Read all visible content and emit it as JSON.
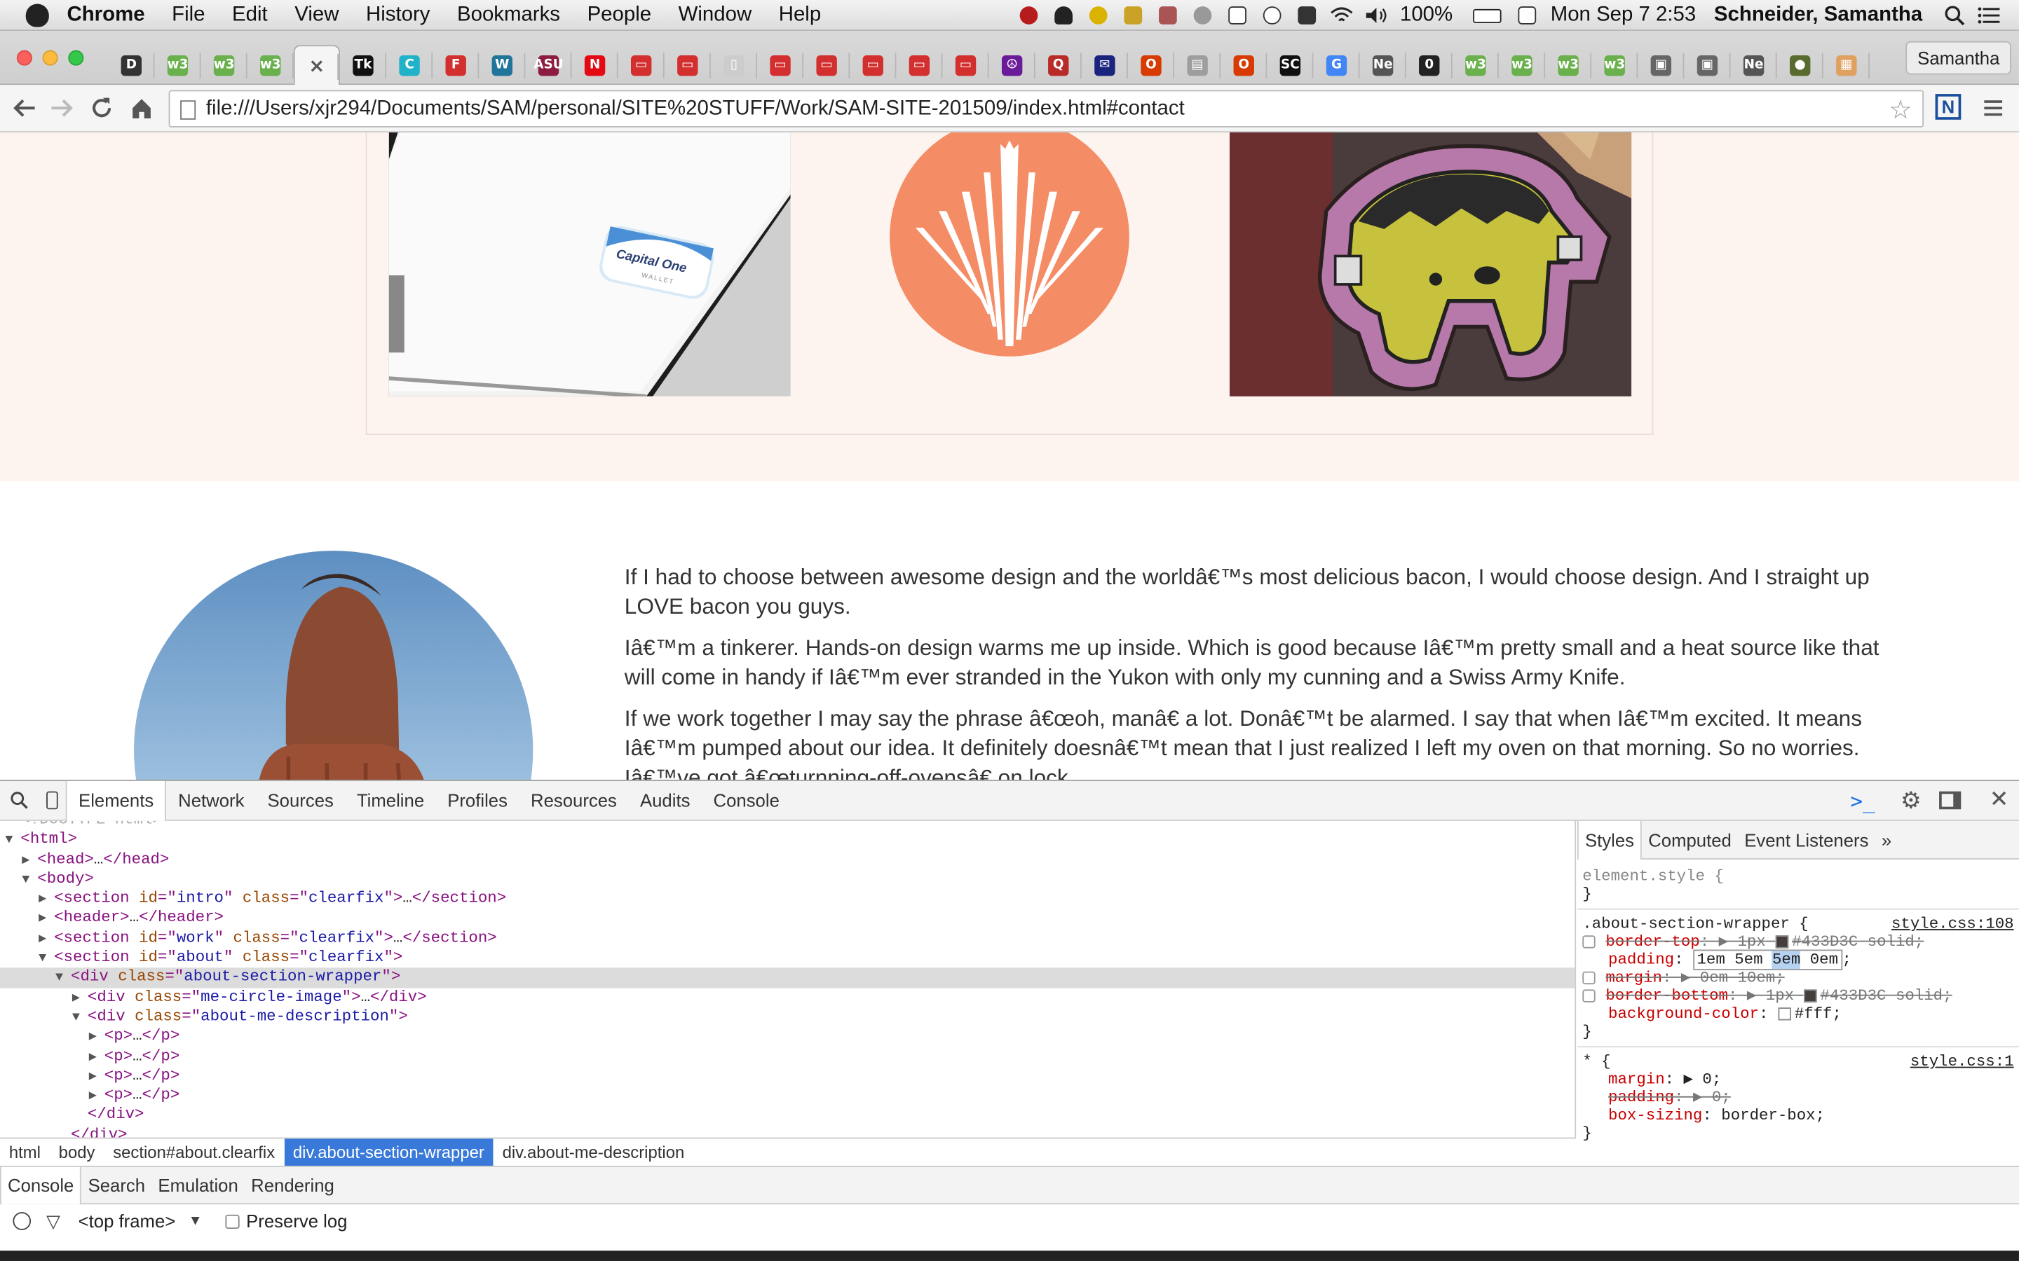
{
  "menubar": {
    "app": "Chrome",
    "items": [
      "File",
      "Edit",
      "View",
      "History",
      "Bookmarks",
      "People",
      "Window",
      "Help"
    ],
    "battery": "100%",
    "datetime": "Mon Sep 7  2:53",
    "user": "Schneider, Samantha"
  },
  "tabstrip": {
    "tabs": [
      {
        "fav": "D",
        "color": "#333333"
      },
      {
        "fav": "w3",
        "color": "#6ab04c"
      },
      {
        "fav": "w3",
        "color": "#6ab04c"
      },
      {
        "fav": "w3",
        "color": "#6ab04c"
      },
      {
        "fav": "×",
        "color": "#f5f5f5",
        "active": true
      },
      {
        "fav": "Tk",
        "color": "#111111"
      },
      {
        "fav": "C",
        "color": "#20b2c9"
      },
      {
        "fav": "F",
        "color": "#d32f2f"
      },
      {
        "fav": "W",
        "color": "#21759b"
      },
      {
        "fav": "ASU",
        "color": "#8c1d40"
      },
      {
        "fav": "N",
        "color": "#e50914"
      },
      {
        "fav": "▭",
        "color": "#d32f2f"
      },
      {
        "fav": "▭",
        "color": "#d32f2f"
      },
      {
        "fav": "▯",
        "color": "#cccccc"
      },
      {
        "fav": "▭",
        "color": "#d32f2f"
      },
      {
        "fav": "▭",
        "color": "#d32f2f"
      },
      {
        "fav": "▭",
        "color": "#d32f2f"
      },
      {
        "fav": "▭",
        "color": "#d32f2f"
      },
      {
        "fav": "▭",
        "color": "#d32f2f"
      },
      {
        "fav": "☮",
        "color": "#6a1b9a"
      },
      {
        "fav": "Q",
        "color": "#b92b27"
      },
      {
        "fav": "✉",
        "color": "#1a237e"
      },
      {
        "fav": "O",
        "color": "#d83b01"
      },
      {
        "fav": "▤",
        "color": "#9e9e9e"
      },
      {
        "fav": "O",
        "color": "#d83b01"
      },
      {
        "fav": "SC",
        "color": "#111111"
      },
      {
        "fav": "G",
        "color": "#4285f4"
      },
      {
        "fav": "Ne",
        "color": "#555555"
      },
      {
        "fav": "0",
        "color": "#222222"
      },
      {
        "fav": "w3",
        "color": "#6ab04c"
      },
      {
        "fav": "w3",
        "color": "#6ab04c"
      },
      {
        "fav": "w3",
        "color": "#6ab04c"
      },
      {
        "fav": "w3",
        "color": "#6ab04c"
      },
      {
        "fav": "▣",
        "color": "#666666"
      },
      {
        "fav": "▣",
        "color": "#666666"
      },
      {
        "fav": "Ne",
        "color": "#555555"
      },
      {
        "fav": "●",
        "color": "#5a6b2f"
      },
      {
        "fav": "▦",
        "color": "#e0a060"
      }
    ],
    "profile": "Samantha"
  },
  "toolbar": {
    "url": "file:///Users/xjr294/Documents/SAM/personal/SITE%20STUFF/Work/SAM-SITE-201509/index.html#contact"
  },
  "page": {
    "thumb1_label": "Capital One",
    "thumb1_sub": "WALLET",
    "paragraphs": [
      "If I had to choose between awesome design and the worldâ€™s most delicious bacon, I would choose design. And I straight up LOVE bacon you guys.",
      "Iâ€™m a tinkerer. Hands-on design warms me up inside. Which is good because Iâ€™m pretty small and a heat source like that will come in handy if Iâ€™m ever stranded in the Yukon with only my cunning and a Swiss Army Knife.",
      "If we work together I may say the phrase â€œoh, manâ€ a lot. Donâ€™t be alarmed. I say that when Iâ€™m excited. It means Iâ€™m pumped about our idea. It definitely doesnâ€™t mean that I just realized I left my oven on that morning. So no worries. Iâ€™ve got â€œturnning-off-ovensâ€ on lock."
    ]
  },
  "devtools": {
    "tabs": [
      "Elements",
      "Network",
      "Sources",
      "Timeline",
      "Profiles",
      "Resources",
      "Audits",
      "Console"
    ],
    "dom": [
      {
        "indent": 0,
        "tri": "",
        "html": "&lt;!DOCTYPE html&gt;",
        "cls": "doctype"
      },
      {
        "indent": 0,
        "tri": "▼",
        "parts": [
          [
            "tag",
            "<html>"
          ]
        ]
      },
      {
        "indent": 1,
        "tri": "▶",
        "parts": [
          [
            "tag",
            "<head>"
          ],
          [
            "txt",
            "…"
          ],
          [
            "tag",
            "</head>"
          ]
        ]
      },
      {
        "indent": 1,
        "tri": "▼",
        "parts": [
          [
            "tag",
            "<body>"
          ]
        ]
      },
      {
        "indent": 2,
        "tri": "▶",
        "parts": [
          [
            "tag",
            "<section "
          ],
          [
            "an",
            "id"
          ],
          [
            "tag",
            "=\""
          ],
          [
            "av",
            "intro"
          ],
          [
            "tag",
            "\" "
          ],
          [
            "an",
            "class"
          ],
          [
            "tag",
            "=\""
          ],
          [
            "av",
            "clearfix"
          ],
          [
            "tag",
            "\">"
          ],
          [
            "txt",
            "…"
          ],
          [
            "tag",
            "</section>"
          ]
        ]
      },
      {
        "indent": 2,
        "tri": "▶",
        "parts": [
          [
            "tag",
            "<header>"
          ],
          [
            "txt",
            "…"
          ],
          [
            "tag",
            "</header>"
          ]
        ]
      },
      {
        "indent": 2,
        "tri": "▶",
        "parts": [
          [
            "tag",
            "<section "
          ],
          [
            "an",
            "id"
          ],
          [
            "tag",
            "=\""
          ],
          [
            "av",
            "work"
          ],
          [
            "tag",
            "\" "
          ],
          [
            "an",
            "class"
          ],
          [
            "tag",
            "=\""
          ],
          [
            "av",
            "clearfix"
          ],
          [
            "tag",
            "\">"
          ],
          [
            "txt",
            "…"
          ],
          [
            "tag",
            "</section>"
          ]
        ]
      },
      {
        "indent": 2,
        "tri": "▼",
        "parts": [
          [
            "tag",
            "<section "
          ],
          [
            "an",
            "id"
          ],
          [
            "tag",
            "=\""
          ],
          [
            "av",
            "about"
          ],
          [
            "tag",
            "\" "
          ],
          [
            "an",
            "class"
          ],
          [
            "tag",
            "=\""
          ],
          [
            "av",
            "clearfix"
          ],
          [
            "tag",
            "\">"
          ]
        ]
      },
      {
        "indent": 3,
        "tri": "▼",
        "sel": true,
        "parts": [
          [
            "tag",
            "<div "
          ],
          [
            "an",
            "class"
          ],
          [
            "tag",
            "=\""
          ],
          [
            "av",
            "about-section-wrapper"
          ],
          [
            "tag",
            "\">"
          ]
        ]
      },
      {
        "indent": 4,
        "tri": "▶",
        "parts": [
          [
            "tag",
            "<div "
          ],
          [
            "an",
            "class"
          ],
          [
            "tag",
            "=\""
          ],
          [
            "av",
            "me-circle-image"
          ],
          [
            "tag",
            "\">"
          ],
          [
            "txt",
            "…"
          ],
          [
            "tag",
            "</div>"
          ]
        ]
      },
      {
        "indent": 4,
        "tri": "▼",
        "parts": [
          [
            "tag",
            "<div "
          ],
          [
            "an",
            "class"
          ],
          [
            "tag",
            "=\""
          ],
          [
            "av",
            "about-me-description"
          ],
          [
            "tag",
            "\">"
          ]
        ]
      },
      {
        "indent": 5,
        "tri": "▶",
        "parts": [
          [
            "tag",
            "<p>"
          ],
          [
            "txt",
            "…"
          ],
          [
            "tag",
            "</p>"
          ]
        ]
      },
      {
        "indent": 5,
        "tri": "▶",
        "parts": [
          [
            "tag",
            "<p>"
          ],
          [
            "txt",
            "…"
          ],
          [
            "tag",
            "</p>"
          ]
        ]
      },
      {
        "indent": 5,
        "tri": "▶",
        "parts": [
          [
            "tag",
            "<p>"
          ],
          [
            "txt",
            "…"
          ],
          [
            "tag",
            "</p>"
          ]
        ]
      },
      {
        "indent": 5,
        "tri": "▶",
        "parts": [
          [
            "tag",
            "<p>"
          ],
          [
            "txt",
            "…"
          ],
          [
            "tag",
            "</p>"
          ]
        ]
      },
      {
        "indent": 4,
        "tri": "",
        "parts": [
          [
            "tag",
            "</div>"
          ]
        ]
      },
      {
        "indent": 3,
        "tri": "",
        "parts": [
          [
            "tag",
            "</div>"
          ]
        ]
      }
    ],
    "breadcrumbs": [
      "html",
      "body",
      "section#about.clearfix",
      "div.about-section-wrapper",
      "div.about-me-description"
    ],
    "styles_tabs": [
      "Styles",
      "Computed",
      "Event Listeners",
      "»"
    ],
    "element_style": "element.style {",
    "rule1": {
      "selector": ".about-section-wrapper {",
      "source": "style.css:108",
      "border_top_prop": "border-top",
      "border_top_val": "1px",
      "border_top_color": "#433D3C",
      "border_top_style": "solid;",
      "padding_prop": "padding",
      "padding_val_a": "1em 5em ",
      "padding_val_hl": "5em",
      "padding_val_b": " 0em",
      "margin_prop": "margin",
      "margin_val": "0em 10em;",
      "border_bottom_prop": "border-bottom",
      "border_bottom_val": "1px",
      "border_bottom_color": "#433D3C",
      "border_bottom_style": "solid;",
      "bg_prop": "background-color",
      "bg_val": "#fff;"
    },
    "rule2": {
      "selector": "* {",
      "source": "style.css:1",
      "margin_prop": "margin",
      "margin_val": "0;",
      "padding_prop": "padding",
      "padding_val": "0;",
      "box_prop": "box-sizing",
      "box_val": "border-box;"
    },
    "drawer_tabs": [
      "Console",
      "Search",
      "Emulation",
      "Rendering"
    ],
    "console": {
      "frame": "<top frame>",
      "preserve_log": "Preserve log"
    }
  }
}
